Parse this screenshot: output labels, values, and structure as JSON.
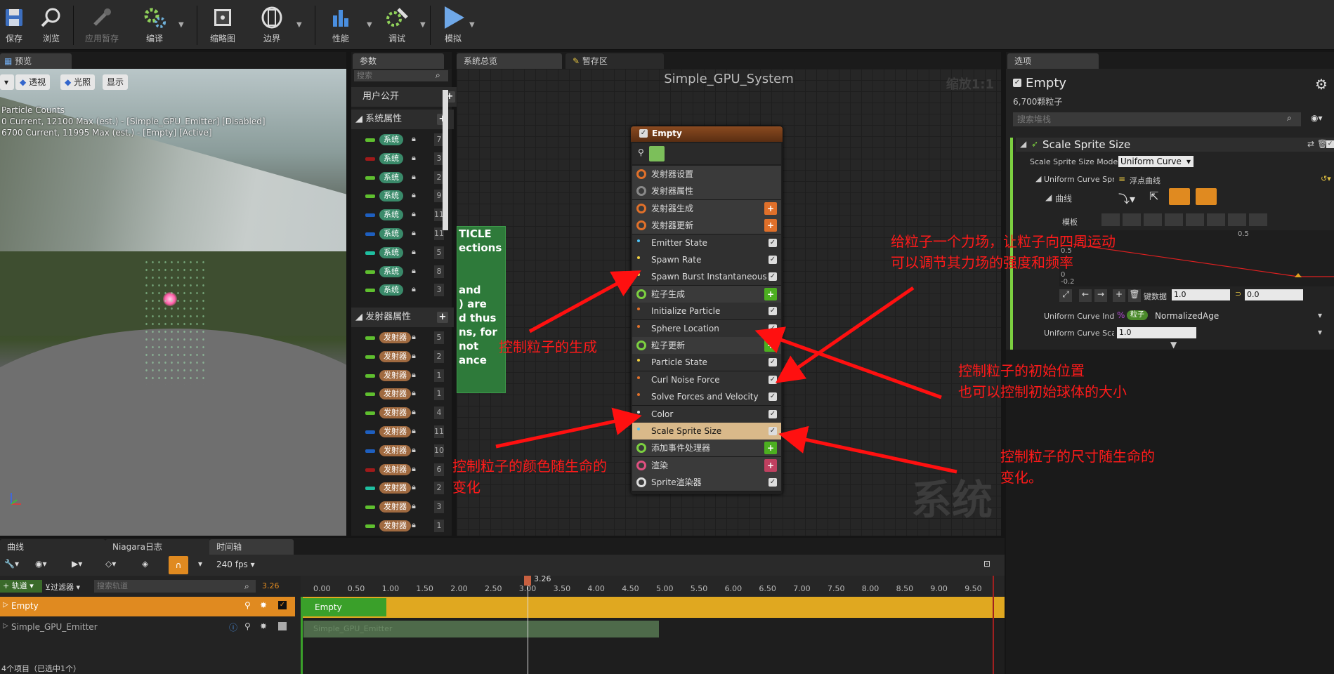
{
  "toolbar": {
    "buttons": [
      {
        "label": "保存",
        "icon": "save-icon"
      },
      {
        "label": "浏览",
        "icon": "browse-icon"
      },
      {
        "label": "应用暂存",
        "icon": "apply-icon"
      },
      {
        "label": "编译",
        "icon": "compile-icon"
      },
      {
        "label": "缩略图",
        "icon": "thumbnail-icon"
      },
      {
        "label": "边界",
        "icon": "bounds-icon"
      },
      {
        "label": "性能",
        "icon": "performance-icon"
      },
      {
        "label": "调试",
        "icon": "debug-icon"
      },
      {
        "label": "模拟",
        "icon": "play-icon"
      }
    ]
  },
  "viewport": {
    "tab": "预览",
    "btn_perspective": "透视",
    "btn_lit": "光照",
    "btn_show": "显示",
    "stats": [
      "Particle Counts",
      "0 Current, 12100 Max (est.) - [Simple_GPU_Emitter] [Disabled]",
      "6700 Current, 11995 Max (est.) - [Empty] [Active]"
    ]
  },
  "params": {
    "tab": "参数",
    "search_placeholder": "搜索",
    "user_section": "用户公开",
    "system_section": "系统属性",
    "system_rows": [
      {
        "label": "系统",
        "color": "#5fbf2f",
        "value": "7"
      },
      {
        "label": "系统",
        "color": "#a01a1a",
        "value": "3"
      },
      {
        "label": "系统",
        "color": "#5fbf2f",
        "value": "2"
      },
      {
        "label": "系统",
        "color": "#5fbf2f",
        "value": "9"
      },
      {
        "label": "系统",
        "color": "#1e5fbf",
        "value": "11"
      },
      {
        "label": "系统",
        "color": "#1e5fbf",
        "value": "11"
      },
      {
        "label": "系统",
        "color": "#1fbfa0",
        "value": "5"
      },
      {
        "label": "系统",
        "color": "#5fbf2f",
        "value": "8"
      },
      {
        "label": "系统",
        "color": "#5fbf2f",
        "value": "3"
      }
    ],
    "emitter_section": "发射器属性",
    "emitter_rows": [
      {
        "label": "发射器",
        "color": "#5fbf2f",
        "value": "5"
      },
      {
        "label": "发射器",
        "color": "#5fbf2f",
        "value": "2"
      },
      {
        "label": "发射器",
        "color": "#5fbf2f",
        "value": "1"
      },
      {
        "label": "发射器",
        "color": "#5fbf2f",
        "value": "1"
      },
      {
        "label": "发射器",
        "color": "#5fbf2f",
        "value": "4"
      },
      {
        "label": "发射器",
        "color": "#1e5fbf",
        "value": "11"
      },
      {
        "label": "发射器",
        "color": "#1e5fbf",
        "value": "10"
      },
      {
        "label": "发射器",
        "color": "#a01a1a",
        "value": "6"
      },
      {
        "label": "发射器",
        "color": "#1fbfa0",
        "value": "2"
      },
      {
        "label": "发射器",
        "color": "#5fbf2f",
        "value": "3"
      },
      {
        "label": "发射器",
        "color": "#5fbf2f",
        "value": "1"
      }
    ]
  },
  "graph": {
    "tab_overview": "系统总览",
    "tab_scratch": "暂存区",
    "title": "Simple_GPU_System",
    "zoom": "缩放1:1",
    "watermark": "系统",
    "comment_lines": [
      "TICLE",
      "ections",
      "",
      "",
      "and",
      ") are",
      "d thus",
      "ns, for",
      "not",
      "ance"
    ],
    "node": {
      "title": "Empty",
      "rows": [
        {
          "label": "发射器设置",
          "kind": "header",
          "icon": "#e0702a"
        },
        {
          "label": "发射器属性",
          "kind": "header",
          "icon": "#888"
        },
        {
          "label": "发射器生成",
          "kind": "header",
          "icon": "#e0702a",
          "add": "#e0702a"
        },
        {
          "label": "发射器更新",
          "kind": "header",
          "icon": "#e0702a",
          "add": "#e0702a"
        },
        {
          "label": "Emitter State",
          "kind": "sub",
          "dot": "#4fc3f7"
        },
        {
          "label": "Spawn Rate",
          "kind": "sub",
          "dot": "#f0d040"
        },
        {
          "label": "Spawn Burst Instantaneous",
          "kind": "sub",
          "dot": "#f0d040"
        },
        {
          "label": "粒子生成",
          "kind": "header",
          "icon": "#7cd040",
          "add": "#4caf20"
        },
        {
          "label": "Initialize Particle",
          "kind": "sub",
          "dot": "#e0702a"
        },
        {
          "label": "Sphere Location",
          "kind": "sub",
          "dot": "#e0702a"
        },
        {
          "label": "粒子更新",
          "kind": "header",
          "icon": "#7cd040",
          "add": "#4caf20"
        },
        {
          "label": "Particle State",
          "kind": "sub",
          "dot": "#f0d040"
        },
        {
          "label": "Curl Noise Force",
          "kind": "sub",
          "dot": "#e0702a"
        },
        {
          "label": "Solve Forces and Velocity",
          "kind": "sub",
          "dot": "#e0702a"
        },
        {
          "label": "Color",
          "kind": "sub",
          "dot": "#dddddd"
        },
        {
          "label": "Scale Sprite Size",
          "kind": "selected",
          "dot": "#4fc3f7"
        },
        {
          "label": "添加事件处理器",
          "kind": "header",
          "icon": "#7cd040",
          "add": "#4caf20"
        },
        {
          "label": "渲染",
          "kind": "header",
          "icon": "#e05080",
          "add": "#c04060"
        },
        {
          "label": "Sprite渲染器",
          "kind": "header",
          "icon": "#dddddd"
        }
      ]
    }
  },
  "details": {
    "tab": "选项",
    "title": "Empty",
    "count": "6,700颗粒子",
    "search_placeholder": "搜索堆栈",
    "module_title": "Scale Sprite Size",
    "mode_label": "Scale Sprite Size Mode",
    "mode_value": "Uniform Curve",
    "curve_row_label": "Uniform Curve Sprite",
    "curve_row_value": "浮点曲线",
    "curve_label": "曲线",
    "template_label": "模板",
    "axis_05": "0.5",
    "axis_1": "1",
    "y_05": "0.5",
    "y_0": "0",
    "y_neg": "-0.2",
    "key_label": "键数据",
    "key_value": "1.0",
    "key_value2": "0.0",
    "index_label": "Uniform Curve Index",
    "index_tag": "粒子",
    "index_value": "NormalizedAge",
    "scale_label": "Uniform Curve Scale",
    "scale_value": "1.0"
  },
  "annotations": {
    "force_1": "给粒子一个力场，让粒子向四周运动",
    "force_2": "可以调节其力场的强度和频率",
    "spawn": "控制粒子的生成",
    "init_1": "控制粒子的初始位置",
    "init_2": "也可以控制初始球体的大小",
    "color_1": "控制粒子的颜色随生命的",
    "color_2": "变化",
    "size_1": "控制粒子的尺寸随生命的",
    "size_2": "变化。"
  },
  "timeline": {
    "tab_curve": "曲线",
    "tab_log": "Niagara日志",
    "tab_timeline": "时间轴",
    "fps": "240 fps",
    "track_btn": "轨道",
    "filter_btn": "过滤器",
    "search_placeholder": "搜索轨道",
    "current_time": "3.26",
    "cursor_label": "3.26",
    "ticks": [
      "0.00",
      "0.50",
      "1.00",
      "1.50",
      "2.00",
      "2.50",
      "3.00",
      "3.50",
      "4.00",
      "4.50",
      "5.00",
      "5.50",
      "6.00",
      "6.50",
      "7.00",
      "7.50",
      "8.00",
      "8.50",
      "9.00",
      "9.50"
    ],
    "track1": "Empty",
    "track2": "Simple_GPU_Emitter",
    "bar1": "Empty",
    "bar2": "Simple_GPU_Emitter",
    "status": "4个项目（已选中1个）"
  }
}
